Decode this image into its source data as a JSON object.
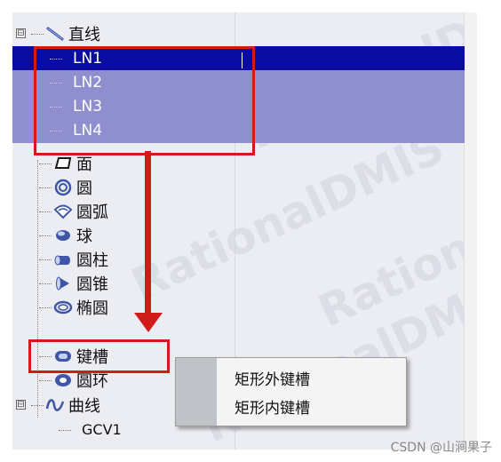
{
  "tree": {
    "items": [
      {
        "id": "line",
        "label": "直线",
        "icon": "line-icon",
        "expander": "⊟",
        "state": "normal"
      },
      {
        "id": "ln1",
        "label": "LN1",
        "icon": "leaf",
        "state": "selected"
      },
      {
        "id": "ln2",
        "label": "LN2",
        "icon": "leaf",
        "state": "highlighted"
      },
      {
        "id": "ln3",
        "label": "LN3",
        "icon": "leaf",
        "state": "highlighted"
      },
      {
        "id": "ln4",
        "label": "LN4",
        "icon": "leaf",
        "state": "highlighted"
      },
      {
        "id": "face",
        "label": "面",
        "icon": "face-icon",
        "state": "normal"
      },
      {
        "id": "circle",
        "label": "圆",
        "icon": "circle-icon",
        "state": "normal"
      },
      {
        "id": "arc",
        "label": "圆弧",
        "icon": "arc-icon",
        "state": "normal"
      },
      {
        "id": "sphere",
        "label": "球",
        "icon": "sphere-icon",
        "state": "normal"
      },
      {
        "id": "cylinder",
        "label": "圆柱",
        "icon": "cylinder-icon",
        "state": "normal"
      },
      {
        "id": "cone",
        "label": "圆锥",
        "icon": "cone-icon",
        "state": "normal"
      },
      {
        "id": "ellipse",
        "label": "椭圆",
        "icon": "ellipse-icon",
        "state": "normal"
      },
      {
        "id": "keyway",
        "label": "键槽",
        "icon": "keyway-icon",
        "state": "normal"
      },
      {
        "id": "ring",
        "label": "圆环",
        "icon": "ring-icon",
        "state": "normal"
      },
      {
        "id": "curve",
        "label": "曲线",
        "icon": "curve-icon",
        "expander": "⊟",
        "state": "normal"
      },
      {
        "id": "gcv1",
        "label": "GCV1",
        "icon": "leaf",
        "state": "normal"
      }
    ]
  },
  "context_menu": {
    "items": [
      {
        "label": "矩形外键槽"
      },
      {
        "label": "矩形内键槽"
      }
    ]
  },
  "watermark": {
    "text": "RationalDMIS"
  },
  "footer": {
    "credit": "CSDN @山涧果子"
  },
  "colors": {
    "selected_bg": "#0a0ba1",
    "highlight_bg": "#8f8fd0",
    "annotation_red": "#d01b1b",
    "icon_blue": "#3f56a8"
  }
}
